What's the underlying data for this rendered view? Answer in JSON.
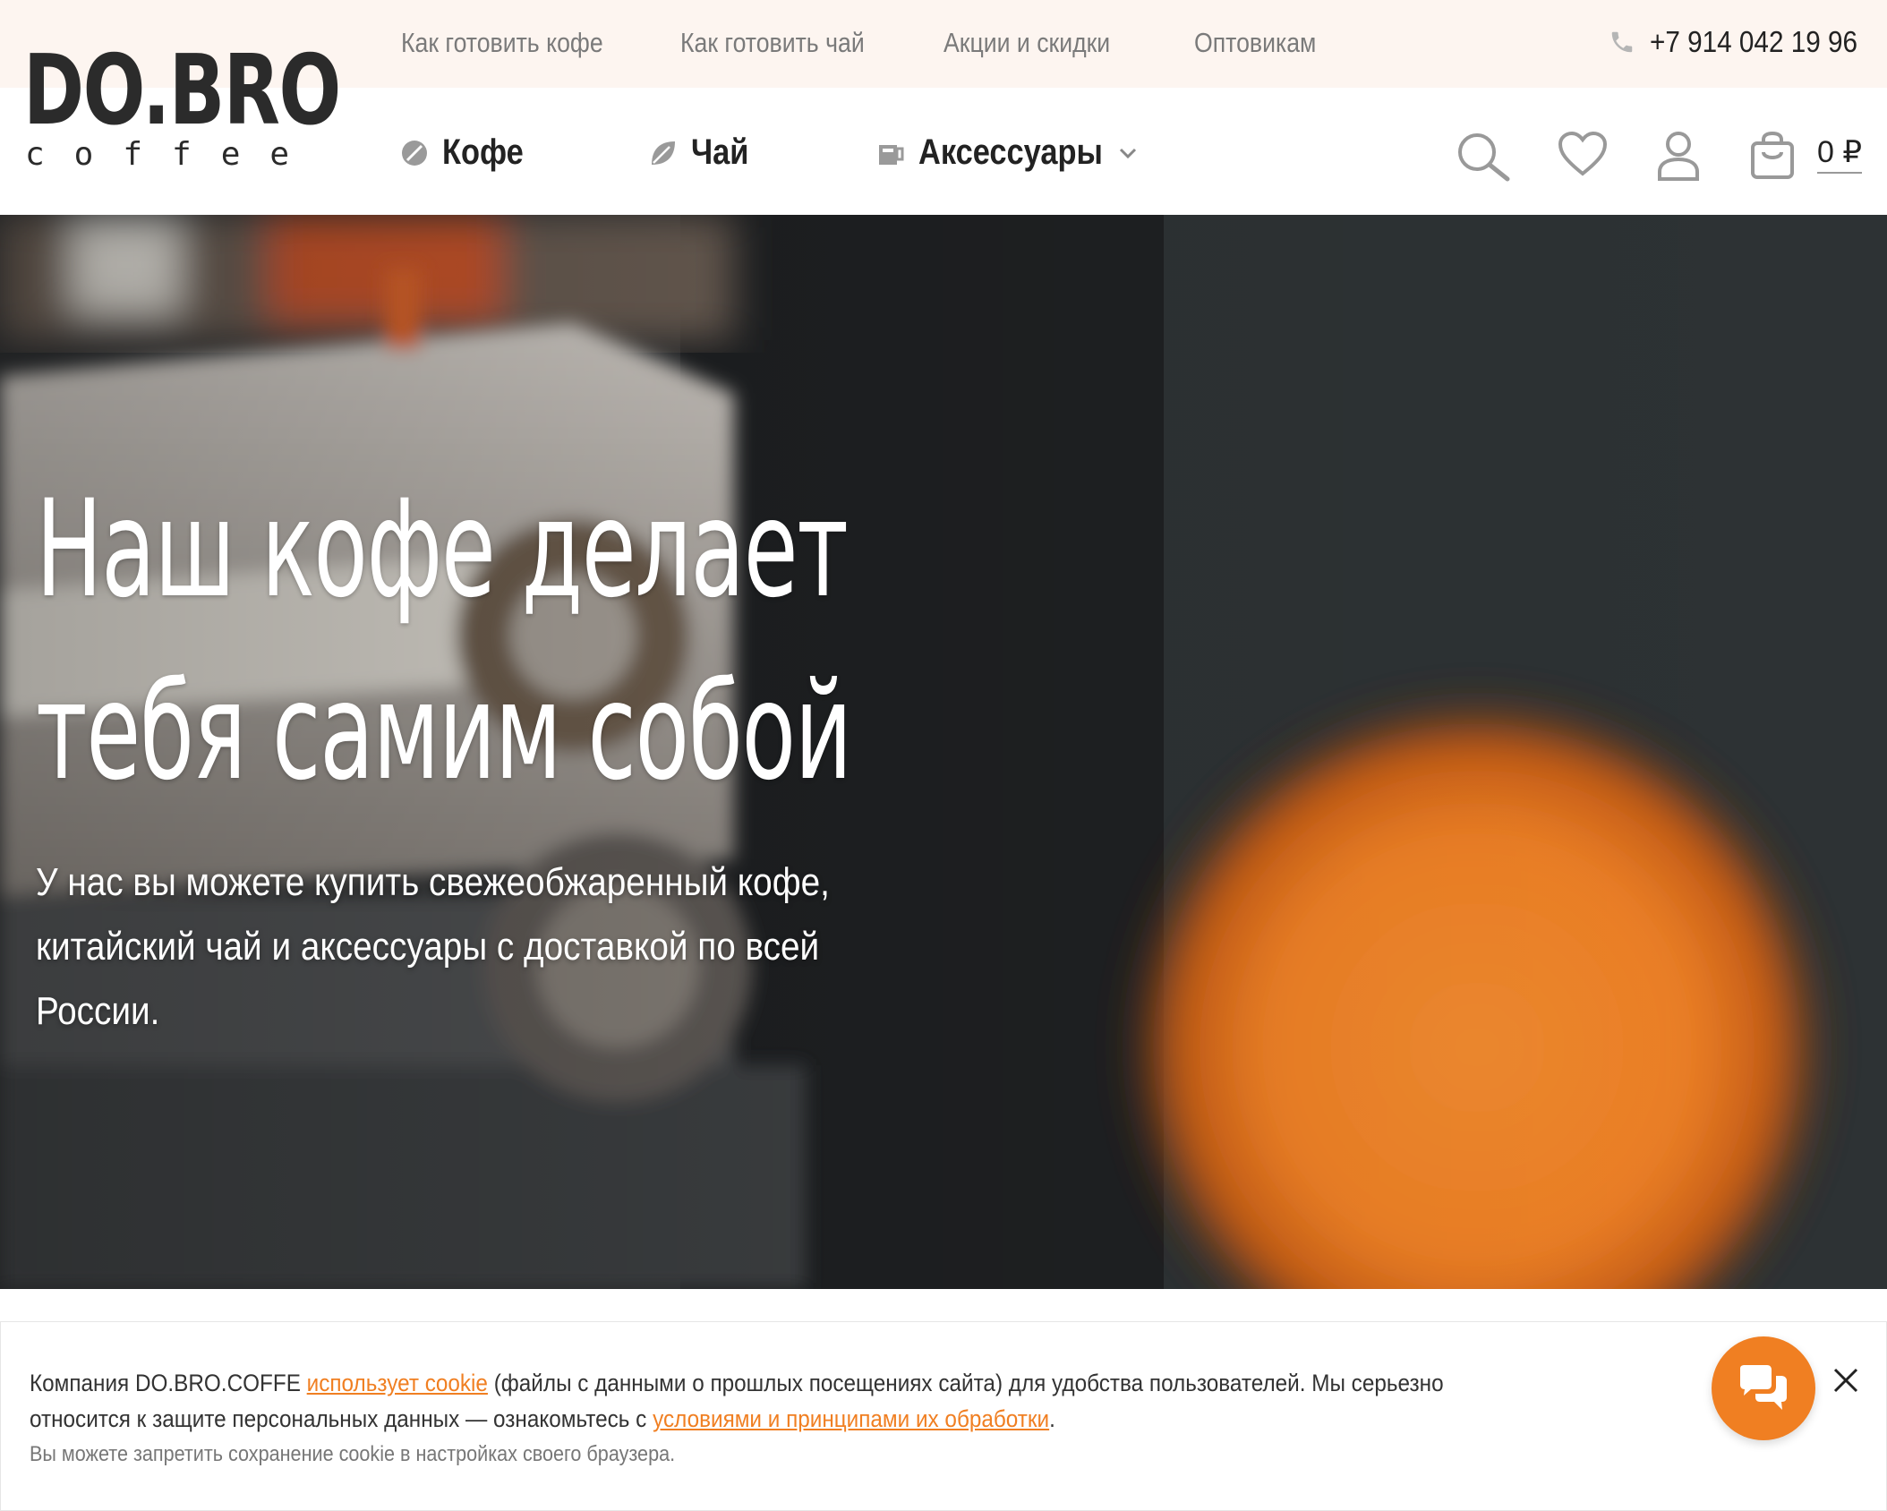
{
  "logo": {
    "main": "DO.BRO",
    "sub": "coffee"
  },
  "top_nav": [
    {
      "label": "Как готовить кофе"
    },
    {
      "label": "Как готовить чай"
    },
    {
      "label": "Акции и скидки"
    },
    {
      "label": "Оптовикам"
    }
  ],
  "phone": "+7 914 042 19 96",
  "main_nav": [
    {
      "label": "Кофе",
      "icon": "coffee-bean-icon"
    },
    {
      "label": "Чай",
      "icon": "tea-leaf-icon"
    },
    {
      "label": "Аксессуары",
      "icon": "accessories-icon",
      "has_dropdown": true
    }
  ],
  "header_icons": [
    "search-icon",
    "heart-icon",
    "user-icon",
    "cart-icon"
  ],
  "cart": {
    "total": "0 ₽"
  },
  "hero": {
    "title_line1": "Наш кофе делает",
    "title_line2": "тебя самим собой",
    "subtitle": "У нас вы можете купить свежеобжаренный кофе, китайский чай и аксессуары с доставкой по всей России."
  },
  "cookie": {
    "text_1": "Компания DO.BRO.COFFE ",
    "link_1": "использует cookie",
    "text_2": " (файлы с данными о прошлых посещениях сайта) для удобства пользователей. Мы серьезно относится к защите персональных данных — ознакомьтесь с ",
    "link_2": "условиями и принципами их обработки",
    "text_3": ".",
    "note": "Вы можете запретить сохранение cookie в настройках своего браузера."
  },
  "colors": {
    "accent": "#f07f22",
    "topbar_bg": "#fdf5f0",
    "text_dark": "#222222"
  }
}
